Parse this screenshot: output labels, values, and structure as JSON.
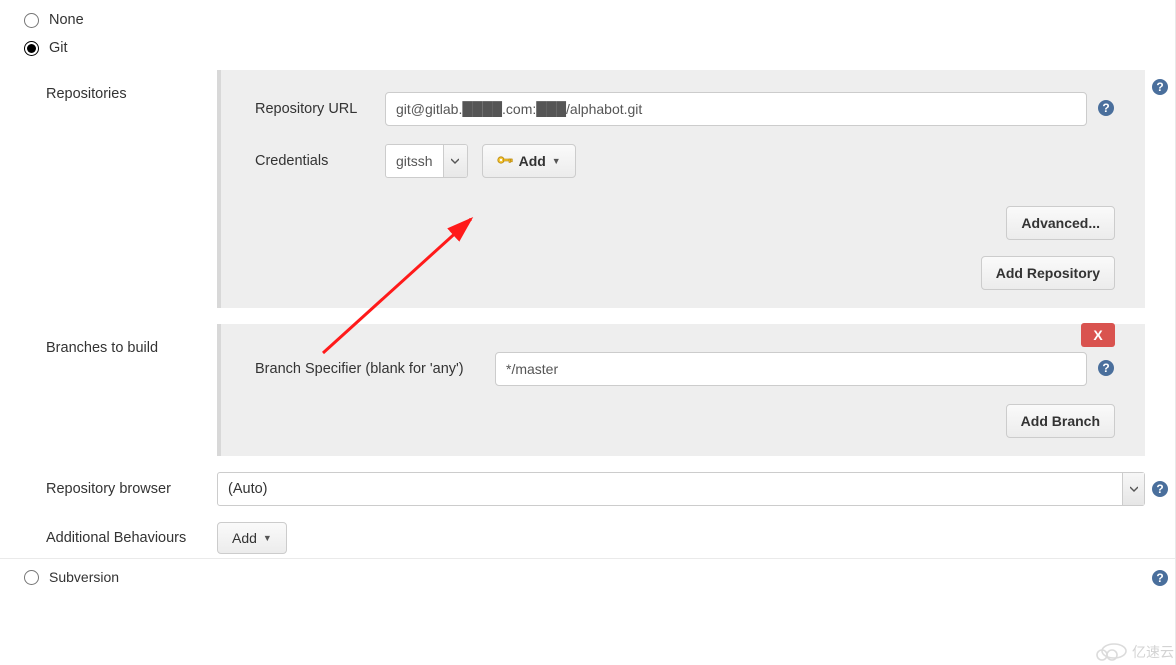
{
  "scm": {
    "none_label": "None",
    "git_label": "Git",
    "subversion_label": "Subversion"
  },
  "repositories": {
    "section_label": "Repositories",
    "url_label": "Repository URL",
    "url_value": "git@gitlab.████.com:███/alphabot.git",
    "credentials_label": "Credentials",
    "credentials_selected": "gitssh",
    "add_credentials_label": "Add",
    "advanced_button": "Advanced...",
    "add_repo_button": "Add Repository"
  },
  "branches": {
    "section_label": "Branches to build",
    "specifier_label": "Branch Specifier (blank for 'any')",
    "specifier_value": "*/master",
    "add_branch_button": "Add Branch",
    "delete_label": "X"
  },
  "repo_browser": {
    "label": "Repository browser",
    "selected": "(Auto)"
  },
  "behaviours": {
    "label": "Additional Behaviours",
    "add_label": "Add"
  },
  "icons": {
    "help": "help-icon",
    "caret": "▾",
    "key": "key-icon"
  },
  "watermark": {
    "text": "亿速云"
  }
}
